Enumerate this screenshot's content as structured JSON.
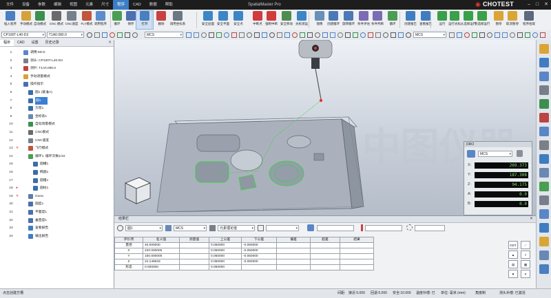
{
  "app": {
    "title": "SpatialMaster Pro",
    "brand": "CHOTEST",
    "watermark": "CHOTEST 中图仪器"
  },
  "menu": [
    "文件",
    "设备",
    "参数",
    "编辑",
    "视图",
    "元素",
    "尺寸",
    "程序",
    "CAD",
    "数据",
    "帮助"
  ],
  "menu_active": "程序",
  "ribbon": [
    {
      "label": "插入程序",
      "color": "#4a7fc1"
    },
    {
      "label": "手动模式",
      "color": "#d5a23a"
    },
    {
      "label": "自动模式",
      "color": "#3b8f4f"
    },
    {
      "label": "CNC 模式",
      "color": "#6a6a6a"
    },
    {
      "label": "CNC速度",
      "color": "#777f8a"
    },
    {
      "label": "FLY模式",
      "color": "#c2553b"
    },
    {
      "label": "调用程序",
      "color": "#5b8ccc"
    },
    {
      "label": "循环",
      "color": "#4a9d53"
    },
    {
      "label": "保存",
      "color": "#4d6fb0"
    },
    {
      "label": "打开",
      "color": "#4a7fc1"
    },
    {
      "label": "删除",
      "color": "#c94040"
    },
    {
      "label": "调用坐标系",
      "color": "#6d7683"
    },
    {
      "label": "安全层面",
      "color": "#3c86c7"
    },
    {
      "label": "安全平面",
      "color": "#3c86c7"
    },
    {
      "label": "安全点",
      "color": "#3c86c7"
    },
    {
      "label": "中断点",
      "color": "#d13b3b"
    },
    {
      "label": "强制中断",
      "color": "#d13b3b"
    },
    {
      "label": "安全移动",
      "color": "#4f8c4f"
    },
    {
      "label": "光校测运",
      "color": "#3c86c7"
    },
    {
      "label": "镜像",
      "color": "#6a8fb8"
    },
    {
      "label": "创建循环",
      "color": "#4b79b8"
    },
    {
      "label": "旋转循环",
      "color": "#4b79b8"
    },
    {
      "label": "条件评估",
      "color": "#7a6db3"
    },
    {
      "label": "条件判断",
      "color": "#7a6db3"
    },
    {
      "label": "循环",
      "color": "#4a9d53"
    },
    {
      "label": "创建报告",
      "color": "#3f7dc0"
    },
    {
      "label": "查看报告",
      "color": "#3f7dc0"
    },
    {
      "label": "运行",
      "color": "#3aa04a"
    },
    {
      "label": "运行光标",
      "color": "#3aa04a"
    },
    {
      "label": "从选择运行",
      "color": "#3aa04a"
    },
    {
      "label": "到选择运行",
      "color": "#3aa04a"
    },
    {
      "label": "暂停",
      "color": "#d9a534"
    },
    {
      "label": "取消暂停",
      "color": "#d9a534"
    },
    {
      "label": "程序拾取",
      "color": "#5b6a7c"
    }
  ],
  "ribbon_active": "打开",
  "toolbar2": {
    "program_combo": "CP100T-L40-D3",
    "tip_combo": "T1A0.080.0",
    "coord_combo": "MCS",
    "coord_combo_right": "MCS"
  },
  "left_panel": {
    "tabs": [
      "程序",
      "CAD",
      "设置",
      "历史记录"
    ],
    "tab_active": "程序",
    "rows": [
      {
        "n": "1",
        "text": "调用:MCS",
        "icon": "#5a86c6",
        "mark": "",
        "indent": 0
      },
      {
        "n": "2",
        "text": "测头: CP100T-L40-D3",
        "icon": "#7a7f88",
        "mark": "",
        "indent": 0
      },
      {
        "n": "3",
        "text": "测针: T1A0.080.0",
        "icon": "#b44",
        "mark": "",
        "indent": 0
      },
      {
        "n": "4",
        "text": "手动测量模式",
        "icon": "#d5a23a",
        "mark": "",
        "indent": 0
      },
      {
        "n": "5",
        "text": "操作指示",
        "icon": "#4a6fb0",
        "mark": "",
        "indent": 0
      },
      {
        "n": "6",
        "text": "圆1 (基准A)",
        "icon": "#3a6ea8",
        "mark": "",
        "indent": 1
      },
      {
        "n": "7",
        "text": "圆1",
        "icon": "#3a6ea8",
        "mark": "",
        "indent": 1,
        "selected": true
      },
      {
        "n": "8",
        "text": "方程1",
        "icon": "#3a6ea8",
        "mark": "",
        "indent": 1
      },
      {
        "n": "9",
        "text": "坐标系1",
        "icon": "#6a88b4",
        "mark": "",
        "indent": 1
      },
      {
        "n": "10",
        "text": "自动测量模式",
        "icon": "#3b8f4f",
        "mark": "",
        "indent": 1
      },
      {
        "n": "11",
        "text": "CNC模式",
        "icon": "#6a6a6a",
        "mark": "",
        "indent": 1
      },
      {
        "n": "12",
        "text": "CNC速度",
        "icon": "#777f8a",
        "mark": "",
        "indent": 1
      },
      {
        "n": "13",
        "text": "飞行模式",
        "icon": "#c2553b",
        "mark": "✕",
        "indent": 1
      },
      {
        "n": "14",
        "text": "循环1: 循环次数1/10",
        "icon": "#4a9d53",
        "mark": "",
        "indent": 1
      },
      {
        "n": "15",
        "text": "圆槽1",
        "icon": "#3a6ea8",
        "mark": "",
        "indent": 2
      },
      {
        "n": "16",
        "text": "椭圆1",
        "icon": "#3a6ea8",
        "mark": "",
        "indent": 2
      },
      {
        "n": "17",
        "text": "圆锥1",
        "icon": "#3a6ea8",
        "mark": "",
        "indent": 2
      },
      {
        "n": "18",
        "text": "圆柱1",
        "icon": "#3a6ea8",
        "mark": "●",
        "indent": 2
      },
      {
        "n": "19",
        "text": "Gona",
        "icon": "#5a7fa8",
        "mark": "✕",
        "indent": 1
      },
      {
        "n": "20",
        "text": "圆度1",
        "icon": "#4a6fb0",
        "mark": "",
        "indent": 1
      },
      {
        "n": "21",
        "text": "平面度1",
        "icon": "#4a6fb0",
        "mark": "",
        "indent": 1
      },
      {
        "n": "22",
        "text": "垂直度1",
        "icon": "#4a6fb0",
        "mark": "",
        "indent": 1
      },
      {
        "n": "23",
        "text": "查看报告",
        "icon": "#3f7dc0",
        "mark": "",
        "indent": 1
      },
      {
        "n": "24",
        "text": "输出报告",
        "icon": "#3f7dc0",
        "mark": "",
        "indent": 1
      }
    ]
  },
  "dro": {
    "title": "DRO",
    "coord": "MCS",
    "rows": [
      {
        "axis": "X:",
        "value": "269.373"
      },
      {
        "axis": "Y:",
        "value": "187.308"
      },
      {
        "axis": "Z:",
        "value": "94.175"
      },
      {
        "axis": "A:",
        "value": "0.0"
      },
      {
        "axis": "B:",
        "value": "0.0"
      }
    ]
  },
  "results": {
    "title": "结果栏",
    "element_combo": "圆1",
    "coord_combo": "MCS",
    "mode_combo": "元素理论值",
    "headers": [
      "评价项",
      "名义值",
      "测量值",
      "上公差",
      "下公差",
      "偏差",
      "超差",
      "结果"
    ],
    "rows": [
      [
        "直径",
        "40.000000",
        "",
        "0.050000",
        "-0.050000",
        "",
        "",
        ""
      ],
      [
        "X",
        "220.000000",
        "",
        "0.050000",
        "-0.050000",
        "",
        "",
        ""
      ],
      [
        "Y",
        "150.000000",
        "",
        "0.050000",
        "-0.050000",
        "",
        "",
        ""
      ],
      [
        "Z",
        "24.148633",
        "",
        "0.050000",
        "-0.050000",
        "",
        "",
        ""
      ],
      [
        "形态",
        "0.000000",
        "",
        "0.050000",
        "",
        "",
        "",
        ""
      ]
    ],
    "gdt_label": "GDT"
  },
  "statusbar": {
    "left": "点击创建方槽",
    "interval_label": "间距:",
    "approach": "接近:5.000",
    "retract": "回退:5.000",
    "safety": "安全:10.000",
    "temp": "温度补偿: 已",
    "unit": "单位: 毫米 (mm)",
    "angle": "角度制",
    "probe": "测头补偿: 已激活"
  }
}
